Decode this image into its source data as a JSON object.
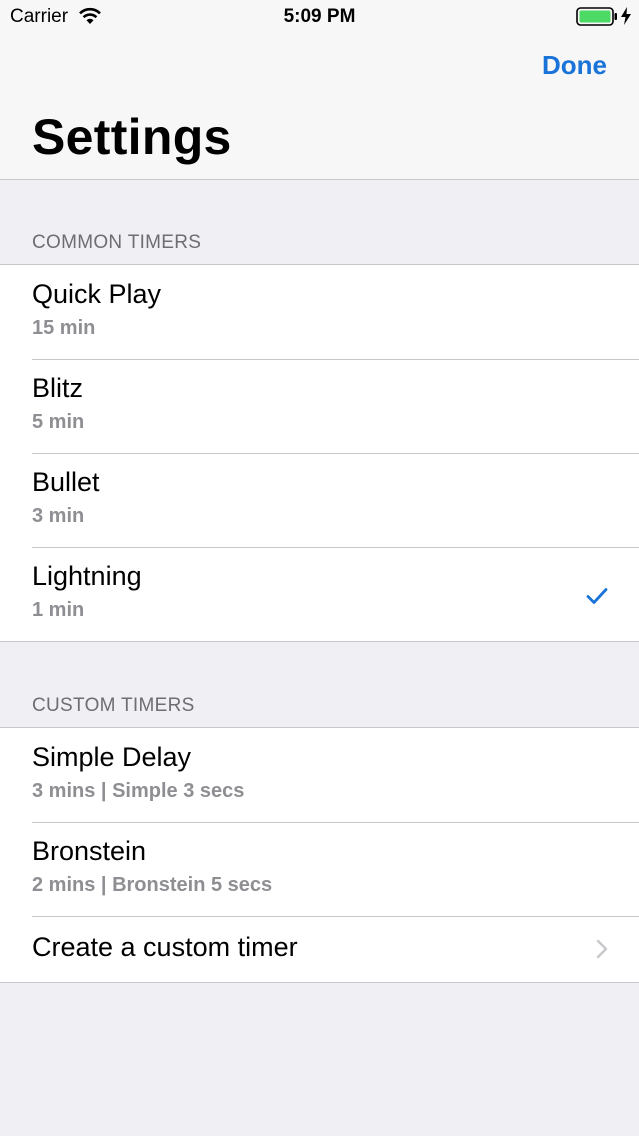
{
  "status_bar": {
    "carrier": "Carrier",
    "time": "5:09 PM",
    "battery_color": "#4cd964"
  },
  "nav": {
    "done_label": "Done",
    "title": "Settings",
    "accent": "#1a73d9"
  },
  "common_timers": {
    "header": "COMMON TIMERS",
    "items": [
      {
        "title": "Quick Play",
        "subtitle": "15 min",
        "selected": false
      },
      {
        "title": "Blitz",
        "subtitle": "5 min",
        "selected": false
      },
      {
        "title": "Bullet",
        "subtitle": "3 min",
        "selected": false
      },
      {
        "title": "Lightning",
        "subtitle": "1 min",
        "selected": true,
        "accessory": "checkmark-icon"
      }
    ]
  },
  "custom_timers": {
    "header": "CUSTOM TIMERS",
    "items": [
      {
        "title": "Simple Delay",
        "subtitle": "3 mins | Simple 3 secs"
      },
      {
        "title": "Bronstein",
        "subtitle": "2 mins | Bronstein 5 secs"
      }
    ],
    "create_label": "Create a custom timer",
    "create_accessory": "chevron-right-icon"
  }
}
